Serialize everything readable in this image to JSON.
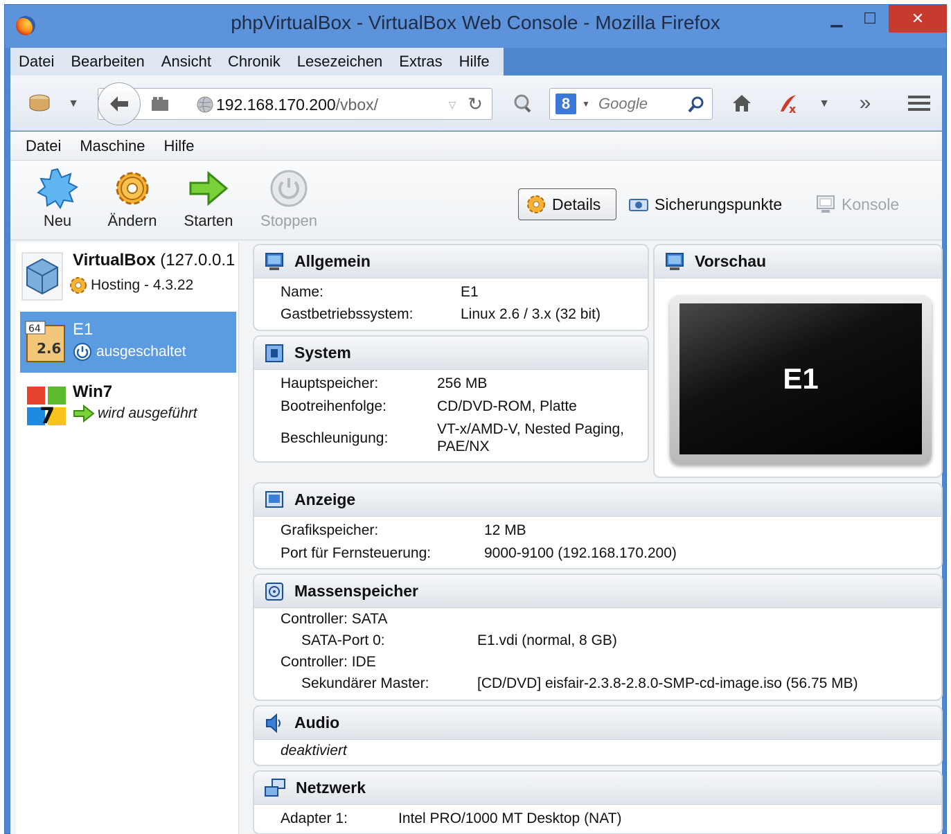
{
  "window": {
    "title": "phpVirtualBox - VirtualBox Web Console - Mozilla Firefox",
    "min_glyph": "▁",
    "max_glyph": "☐",
    "close_glyph": "✕"
  },
  "browser_menu": {
    "items": [
      "Datei",
      "Bearbeiten",
      "Ansicht",
      "Chronik",
      "Lesezeichen",
      "Extras",
      "Hilfe"
    ]
  },
  "navbar": {
    "url_host": "192.168.170.200",
    "url_path": "/vbox/",
    "search_placeholder": "Google",
    "search_engine_badge": "8",
    "overflow_glyph": "»"
  },
  "app_menu": {
    "items": [
      "Datei",
      "Maschine",
      "Hilfe"
    ]
  },
  "toolbar": {
    "new_label": "Neu",
    "change_label": "Ändern",
    "start_label": "Starten",
    "stop_label": "Stoppen"
  },
  "tabs": {
    "details": "Details",
    "snapshots": "Sicherungspunkte",
    "console": "Konsole"
  },
  "vm_list": {
    "host": {
      "name": "VirtualBox",
      "address": "(127.0.0.1",
      "status": "Hosting - 4.3.22"
    },
    "vms": [
      {
        "name": "E1",
        "state": "ausgeschaltet",
        "badge_top": "64",
        "badge_main": "2.6"
      },
      {
        "name": "Win7",
        "state": "wird ausgeführt",
        "badge_main": "7"
      }
    ]
  },
  "details": {
    "general": {
      "title": "Allgemein",
      "name_label": "Name:",
      "name_value": "E1",
      "os_label": "Gastbetriebssystem:",
      "os_value": "Linux 2.6 / 3.x (32 bit)"
    },
    "system": {
      "title": "System",
      "ram_label": "Hauptspeicher:",
      "ram_value": "256 MB",
      "boot_label": "Bootreihenfolge:",
      "boot_value": "CD/DVD-ROM, Platte",
      "accel_label": "Beschleunigung:",
      "accel_value_line1": "VT-x/AMD-V, Nested Paging,",
      "accel_value_line2": "PAE/NX"
    },
    "preview": {
      "title": "Vorschau",
      "screen_text": "E1"
    },
    "display": {
      "title": "Anzeige",
      "vram_label": "Grafikspeicher:",
      "vram_value": "12 MB",
      "remote_label": "Port für Fernsteuerung:",
      "remote_value": "9000-9100 (192.168.170.200)"
    },
    "storage": {
      "title": "Massenspeicher",
      "ctrl1": "Controller: SATA",
      "port0_label": "SATA-Port 0:",
      "port0_value": "E1.vdi (normal, 8 GB)",
      "ctrl2": "Controller: IDE",
      "secmaster_label": "Sekundärer Master:",
      "secmaster_value": "[CD/DVD] eisfair-2.3.8-2.8.0-SMP-cd-image.iso (56.75 MB)"
    },
    "audio": {
      "title": "Audio",
      "value": "deaktiviert"
    },
    "network": {
      "title": "Netzwerk",
      "adapter_label": "Adapter 1:",
      "adapter_value": "Intel PRO/1000 MT Desktop (NAT)"
    }
  }
}
